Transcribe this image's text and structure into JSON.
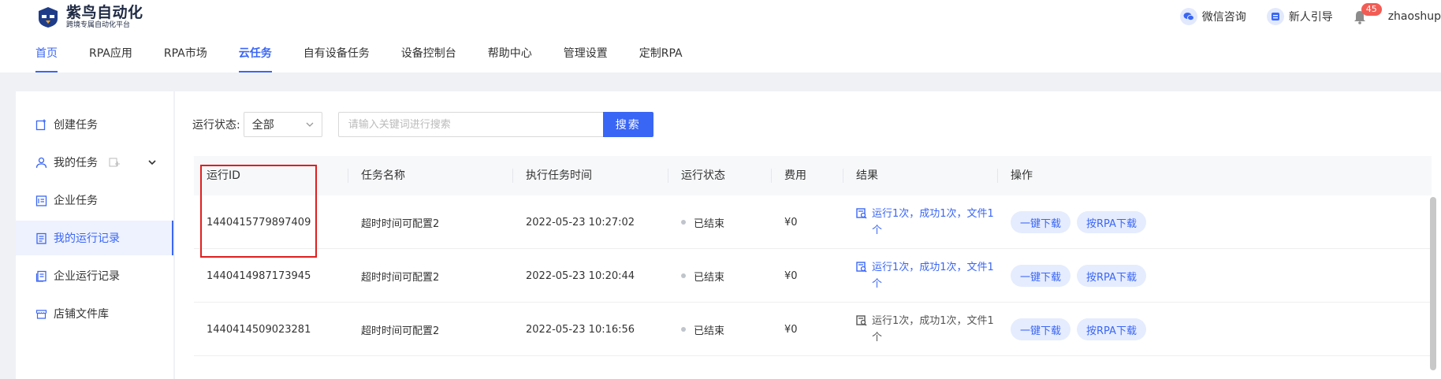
{
  "header": {
    "logo_title": "紫鸟自动化",
    "logo_subtitle": "跨境专属自动化平台",
    "nav": [
      {
        "label": "首页"
      },
      {
        "label": "RPA应用"
      },
      {
        "label": "RPA市场"
      },
      {
        "label": "云任务"
      },
      {
        "label": "自有设备任务"
      },
      {
        "label": "设备控制台"
      },
      {
        "label": "帮助中心"
      },
      {
        "label": "管理设置"
      },
      {
        "label": "定制RPA"
      }
    ],
    "wechat_label": "微信咨询",
    "guide_label": "新人引导",
    "notification_count": "45",
    "username": "zhaoshup"
  },
  "sidebar": {
    "items": [
      {
        "label": "创建任务"
      },
      {
        "label": "我的任务"
      },
      {
        "label": "企业任务"
      },
      {
        "label": "我的运行记录"
      },
      {
        "label": "企业运行记录"
      },
      {
        "label": "店铺文件库"
      }
    ]
  },
  "filter": {
    "status_label": "运行状态:",
    "status_value": "全部",
    "search_placeholder": "请输入关键词进行搜索",
    "search_button": "搜索"
  },
  "table": {
    "columns": [
      "运行ID",
      "任务名称",
      "执行任务时间",
      "运行状态",
      "费用",
      "结果",
      "操作"
    ],
    "rows": [
      {
        "id": "1440415779897409",
        "name": "超时时间可配置2",
        "time": "2022-05-23 10:27:02",
        "status": "已结束",
        "fee": "¥0",
        "result_line1": "运行1次，成功1次，文件1",
        "result_line2": "个",
        "btn1": "一键下载",
        "btn2": "按RPA下载"
      },
      {
        "id": "1440414987173945",
        "name": "超时时间可配置2",
        "time": "2022-05-23 10:20:44",
        "status": "已结束",
        "fee": "¥0",
        "result_line1": "运行1次，成功1次，文件1",
        "result_line2": "个",
        "btn1": "一键下载",
        "btn2": "按RPA下载"
      },
      {
        "id": "1440414509023281",
        "name": "超时时间可配置2",
        "time": "2022-05-23 10:16:56",
        "status": "已结束",
        "fee": "¥0",
        "result_line1": "运行1次，成功1次，文件1",
        "result_line2": "个",
        "btn1": "一键下载",
        "btn2": "按RPA下载"
      }
    ]
  },
  "colors": {
    "accent": "#3a66f5",
    "highlight_box": "#e01f1f",
    "badge": "#f25c54"
  }
}
